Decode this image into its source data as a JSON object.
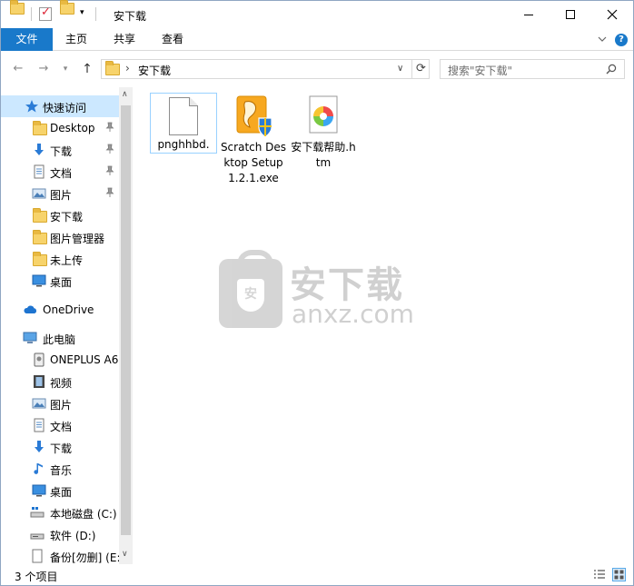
{
  "window": {
    "title": "安下载"
  },
  "ribbon": {
    "tabs": [
      "文件",
      "主页",
      "共享",
      "查看"
    ],
    "help": "?"
  },
  "address": {
    "path": "安下载",
    "search_placeholder": "搜索\"安下载\""
  },
  "sidebar": {
    "quick_access": "快速访问",
    "items": [
      {
        "label": "Desktop",
        "icon": "folder-icon",
        "pinned": true
      },
      {
        "label": "下载",
        "icon": "download-icon",
        "pinned": true
      },
      {
        "label": "文档",
        "icon": "document-icon",
        "pinned": true
      },
      {
        "label": "图片",
        "icon": "picture-icon",
        "pinned": true
      },
      {
        "label": "安下载",
        "icon": "folder-icon",
        "pinned": false
      },
      {
        "label": "图片管理器",
        "icon": "folder-icon",
        "pinned": false
      },
      {
        "label": "未上传",
        "icon": "folder-icon",
        "pinned": false
      },
      {
        "label": "桌面",
        "icon": "desktop-icon",
        "pinned": false
      }
    ],
    "onedrive": "OneDrive",
    "this_pc": "此电脑",
    "pc_items": [
      {
        "label": "ONEPLUS A6",
        "icon": "phone-icon"
      },
      {
        "label": "视频",
        "icon": "video-icon"
      },
      {
        "label": "图片",
        "icon": "picture-icon"
      },
      {
        "label": "文档",
        "icon": "document-icon"
      },
      {
        "label": "下载",
        "icon": "download-icon"
      },
      {
        "label": "音乐",
        "icon": "music-icon"
      },
      {
        "label": "桌面",
        "icon": "desktop-icon"
      },
      {
        "label": "本地磁盘 (C:)",
        "icon": "drive-icon"
      },
      {
        "label": "软件 (D:)",
        "icon": "drive-icon"
      },
      {
        "label": "备份[勿删] (E:",
        "icon": "drive-icon"
      }
    ]
  },
  "files": [
    {
      "name": "pnghhbd.",
      "icon": "blank-file-icon"
    },
    {
      "name": "Scratch Desktop Setup 1.2.1.exe",
      "icon": "installer-icon"
    },
    {
      "name": "安下载帮助.htm",
      "icon": "htm-file-icon"
    }
  ],
  "watermark": {
    "cn": "安下载",
    "en": "anxz.com",
    "shield": "安"
  },
  "status": {
    "count": "3 个项目"
  },
  "colors": {
    "accent": "#1979ca",
    "selection": "#cce8ff",
    "folder": "#f7d36b"
  }
}
